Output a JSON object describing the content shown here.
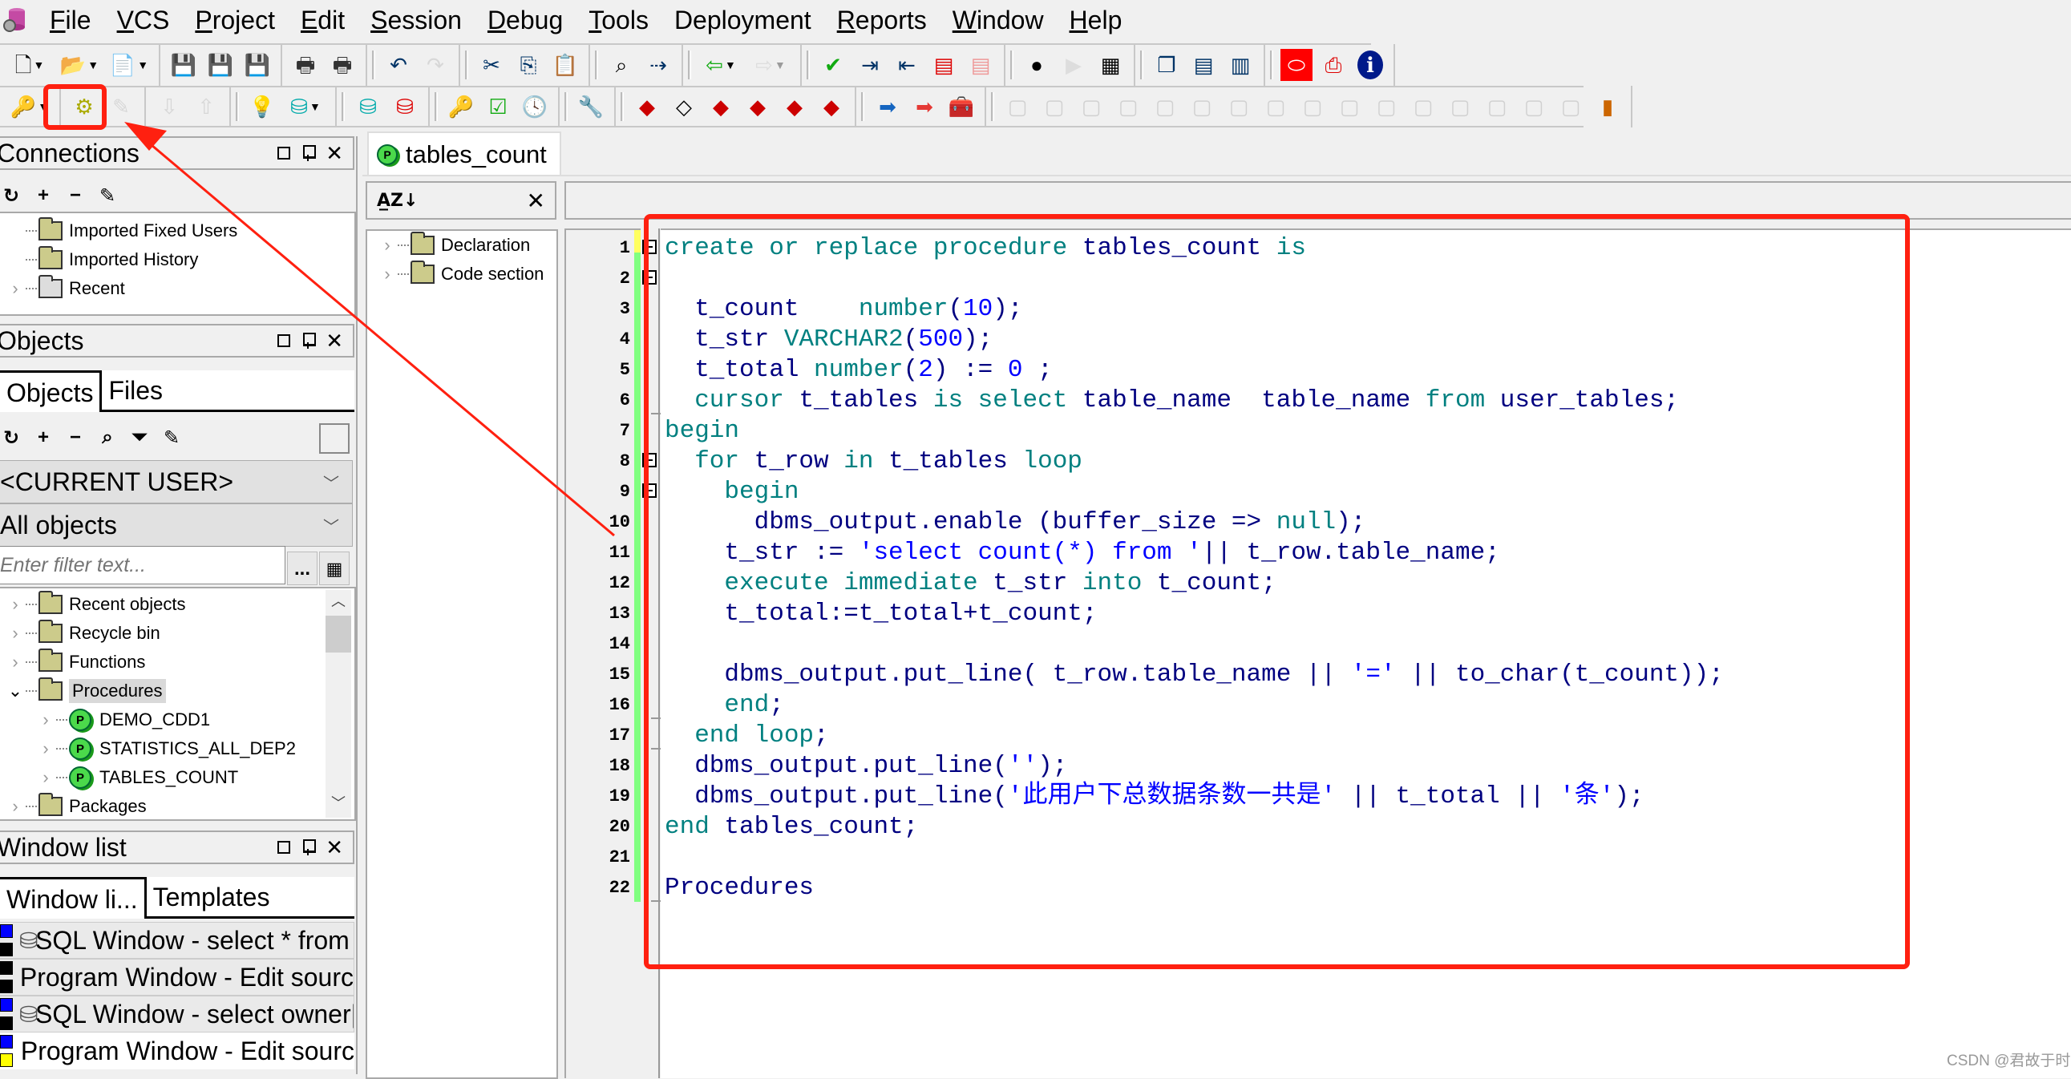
{
  "menubar": {
    "items": [
      {
        "label": "File",
        "accel": "F"
      },
      {
        "label": "VCS",
        "accel": "V"
      },
      {
        "label": "Project",
        "accel": "P"
      },
      {
        "label": "Edit",
        "accel": "E"
      },
      {
        "label": "Session",
        "accel": "S"
      },
      {
        "label": "Debug",
        "accel": "D"
      },
      {
        "label": "Tools",
        "accel": "T"
      },
      {
        "label": "Deployment",
        "accel": ""
      },
      {
        "label": "Reports",
        "accel": "R"
      },
      {
        "label": "Window",
        "accel": "W"
      },
      {
        "label": "Help",
        "accel": "H"
      }
    ]
  },
  "toolbar1": {
    "groups": [
      [
        "new-icon",
        "open-icon",
        "open-template-icon"
      ],
      [
        "save-icon",
        "save-as-icon",
        "save-all-icon"
      ],
      [
        "print-icon",
        "print-setup-icon"
      ],
      [
        "undo-icon",
        "redo-icon"
      ],
      [
        "cut-icon",
        "copy-icon",
        "paste-icon"
      ],
      [
        "find-icon",
        "find-next-icon"
      ],
      [
        "load-icon",
        "reload-icon"
      ],
      [
        "check-syntax-icon",
        "indent-icon",
        "unindent-icon",
        "comment-icon",
        "uncomment-icon"
      ],
      [
        "record-macro-icon",
        "play-macro-icon",
        "macro-library-icon"
      ],
      [
        "window-list-icon",
        "tile-horizontal-icon",
        "tile-vertical-icon"
      ],
      [
        "oracle-icon",
        "pdf-icon",
        "info-icon"
      ]
    ]
  },
  "toolbar2": {
    "groups": [
      [
        "logon-icon"
      ],
      [
        "execute-icon",
        "break-icon"
      ],
      [
        "fetch-next-icon",
        "fetch-last-icon"
      ],
      [
        "explain-plan-icon",
        "sql-template-icon"
      ],
      [
        "query-by-example-icon",
        "rollback-icon"
      ],
      [
        "dba-icon",
        "check-icon",
        "history-icon"
      ],
      [
        "preferences-icon"
      ],
      [
        "vcs-add-icon",
        "vcs-remove-icon",
        "vcs-open-icon",
        "vcs-checkin-icon",
        "vcs-checkout-icon",
        "vcs-undo-icon"
      ],
      [
        "navigate-forward-icon",
        "navigate-back-icon",
        "toolbox-icon"
      ],
      [
        "vcs-disabled-1",
        "vcs-disabled-2",
        "vcs-disabled-3",
        "vcs-disabled-4",
        "vcs-disabled-5",
        "vcs-disabled-6",
        "vcs-disabled-7",
        "vcs-disabled-8",
        "vcs-disabled-9",
        "vcs-disabled-10",
        "vcs-disabled-11",
        "vcs-disabled-12",
        "vcs-disabled-13",
        "vcs-disabled-14",
        "vcs-disabled-15",
        "vcs-disabled-16",
        "vcs-tools-icon"
      ]
    ],
    "highlighted_button": "execute-icon"
  },
  "connections": {
    "title": "Connections",
    "items": [
      {
        "label": "Imported Fixed Users",
        "expandable": false
      },
      {
        "label": "Imported History",
        "expandable": false
      },
      {
        "label": "Recent",
        "expandable": true
      }
    ]
  },
  "objects": {
    "title": "Objects",
    "tabs": [
      "Objects",
      "Files"
    ],
    "active_tab": "Objects",
    "user_select": "<CURRENT USER>",
    "type_select": "All objects",
    "filter_placeholder": "Enter filter text...",
    "filter_more": "...",
    "tree": [
      {
        "label": "Recent objects",
        "type": "folder",
        "level": 0,
        "expanded": false
      },
      {
        "label": "Recycle bin",
        "type": "folder",
        "level": 0,
        "expanded": false
      },
      {
        "label": "Functions",
        "type": "folder",
        "level": 0,
        "expanded": false
      },
      {
        "label": "Procedures",
        "type": "folder",
        "level": 0,
        "expanded": true,
        "selected": true
      },
      {
        "label": "DEMO_CDD1",
        "type": "procedure",
        "level": 1,
        "expanded": false
      },
      {
        "label": "STATISTICS_ALL_DEP2",
        "type": "procedure",
        "level": 1,
        "expanded": false
      },
      {
        "label": "TABLES_COUNT",
        "type": "procedure",
        "level": 1,
        "expanded": false
      },
      {
        "label": "Packages",
        "type": "folder",
        "level": 0,
        "expanded": false
      }
    ]
  },
  "window_list": {
    "title": "Window list",
    "tabs": [
      "Window li...",
      "Templates"
    ],
    "active_tab": "Window li...",
    "items": [
      {
        "label": "SQL Window - select * from u",
        "kind": "sql",
        "flag_top": "#0000ff",
        "flag_bottom": "#000000"
      },
      {
        "label": "Program Window - Edit sourc",
        "kind": "program",
        "flag_top": "#000000",
        "flag_bottom": "#000000"
      },
      {
        "label": "SQL Window - select owner||'",
        "kind": "sql",
        "flag_top": "#0000ff",
        "flag_bottom": "#000000"
      },
      {
        "label": "Program Window - Edit sourc",
        "kind": "program",
        "flag_top": "#0000ff",
        "flag_bottom": "#ffff00"
      }
    ]
  },
  "program_window": {
    "tab_label": "tables_count",
    "structure": {
      "sort_icon": "A↓Z",
      "close_icon": "✕",
      "items": [
        "Declaration",
        "Code section"
      ]
    },
    "editor": {
      "fold_lines": [
        1,
        2,
        8,
        9
      ],
      "lines": [
        [
          [
            "kw",
            "create or replace procedure "
          ],
          [
            "id",
            "tables_count "
          ],
          [
            "kw",
            "is"
          ]
        ],
        [],
        [
          [
            "id",
            "  t_count    "
          ],
          [
            "kw",
            "number"
          ],
          [
            "id",
            "("
          ],
          [
            "num",
            "10"
          ],
          [
            "id",
            ");"
          ]
        ],
        [
          [
            "id",
            "  t_str "
          ],
          [
            "kw",
            "VARCHAR2"
          ],
          [
            "id",
            "("
          ],
          [
            "num",
            "500"
          ],
          [
            "id",
            ");"
          ]
        ],
        [
          [
            "id",
            "  t_total "
          ],
          [
            "kw",
            "number"
          ],
          [
            "id",
            "("
          ],
          [
            "num",
            "2"
          ],
          [
            "id",
            ") := "
          ],
          [
            "num",
            "0"
          ],
          [
            "id",
            " ;"
          ]
        ],
        [
          [
            "kw",
            "  cursor "
          ],
          [
            "id",
            "t_tables "
          ],
          [
            "kw",
            "is select "
          ],
          [
            "id",
            "table_name  table_name "
          ],
          [
            "kw",
            "from "
          ],
          [
            "id",
            "user_tables;"
          ]
        ],
        [
          [
            "kw",
            "begin"
          ]
        ],
        [
          [
            "kw",
            "  for "
          ],
          [
            "id",
            "t_row "
          ],
          [
            "kw",
            "in "
          ],
          [
            "id",
            "t_tables "
          ],
          [
            "kw",
            "loop"
          ]
        ],
        [
          [
            "kw",
            "    begin"
          ]
        ],
        [
          [
            "id",
            "      dbms_output.enable (buffer_size => "
          ],
          [
            "kw",
            "null"
          ],
          [
            "id",
            ");"
          ]
        ],
        [
          [
            "id",
            "    t_str := "
          ],
          [
            "str",
            "'select count(*) from '"
          ],
          [
            "id",
            "|| t_row.table_name;"
          ]
        ],
        [
          [
            "kw",
            "    execute immediate "
          ],
          [
            "id",
            "t_str "
          ],
          [
            "kw",
            "into "
          ],
          [
            "id",
            "t_count;"
          ]
        ],
        [
          [
            "id",
            "    t_total:=t_total+t_count;"
          ]
        ],
        [],
        [
          [
            "id",
            "    dbms_output.put_line( t_row.table_name || "
          ],
          [
            "str",
            "'='"
          ],
          [
            "id",
            " || to_char(t_count));"
          ]
        ],
        [
          [
            "kw",
            "    end"
          ],
          [
            "id",
            ";"
          ]
        ],
        [
          [
            "kw",
            "  end loop"
          ],
          [
            "id",
            ";"
          ]
        ],
        [
          [
            "id",
            "  dbms_output.put_line("
          ],
          [
            "str",
            "''"
          ],
          [
            "id",
            ");"
          ]
        ],
        [
          [
            "id",
            "  dbms_output.put_line("
          ],
          [
            "str",
            "'此用户下总数据条数一共是'"
          ],
          [
            "id",
            " || t_total || "
          ],
          [
            "str",
            "'条'"
          ],
          [
            "id",
            ");"
          ]
        ],
        [
          [
            "kw",
            "end "
          ],
          [
            "id",
            "tables_count;"
          ]
        ],
        [],
        [
          [
            "id",
            "Procedures"
          ]
        ]
      ]
    }
  },
  "annotations": {
    "color": "#ff2010",
    "boxes": [
      "execute-button-highlight",
      "code-editor-highlight"
    ],
    "arrow": "from-code-to-execute-button"
  },
  "watermark": "CSDN @君故于时"
}
